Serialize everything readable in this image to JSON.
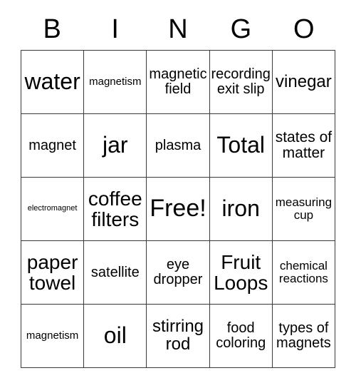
{
  "header": {
    "letters": [
      "B",
      "I",
      "N",
      "G",
      "O"
    ]
  },
  "grid": {
    "rows": [
      [
        {
          "label": "water",
          "size": "fs-xxl"
        },
        {
          "label": "magnetism",
          "size": "fs-xs"
        },
        {
          "label": "magnetic field",
          "size": "fs-m"
        },
        {
          "label": "recording exit slip",
          "size": "fs-m"
        },
        {
          "label": "vinegar",
          "size": "fs-l"
        }
      ],
      [
        {
          "label": "magnet",
          "size": "fs-m"
        },
        {
          "label": "jar",
          "size": "fs-xxl"
        },
        {
          "label": "plasma",
          "size": "fs-m"
        },
        {
          "label": "Total",
          "size": "fs-xxl"
        },
        {
          "label": "states of matter",
          "size": "fs-ml"
        }
      ],
      [
        {
          "label": "electromagnet",
          "size": "fs-xxs"
        },
        {
          "label": "coffee filters",
          "size": "fs-xl"
        },
        {
          "label": "Free!",
          "size": "fs-huge"
        },
        {
          "label": "iron",
          "size": "fs-xxl"
        },
        {
          "label": "measuring cup",
          "size": "fs-s"
        }
      ],
      [
        {
          "label": "paper towel",
          "size": "fs-xl"
        },
        {
          "label": "satellite",
          "size": "fs-m"
        },
        {
          "label": "eye dropper",
          "size": "fs-m"
        },
        {
          "label": "Fruit Loops",
          "size": "fs-xl"
        },
        {
          "label": "chemical reactions",
          "size": "fs-s"
        }
      ],
      [
        {
          "label": "magnetism",
          "size": "fs-xs"
        },
        {
          "label": "oil",
          "size": "fs-xxl"
        },
        {
          "label": "stirring rod",
          "size": "fs-l"
        },
        {
          "label": "food coloring",
          "size": "fs-m"
        },
        {
          "label": "types of magnets",
          "size": "fs-m"
        }
      ]
    ]
  },
  "colors": {
    "grid_line": "#3a3a3a",
    "text": "#000000",
    "background": "#ffffff"
  }
}
